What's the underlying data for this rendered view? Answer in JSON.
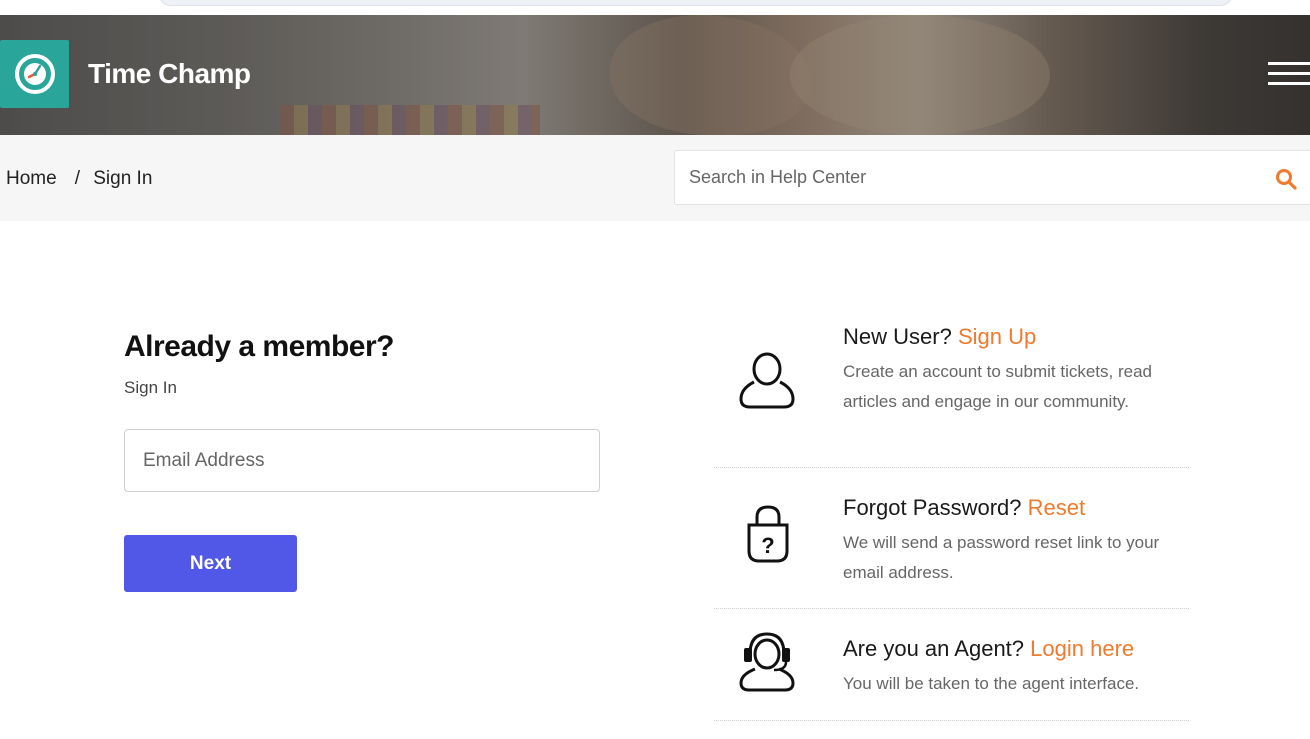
{
  "header": {
    "brand": "Time Champ",
    "menu_icon": "hamburger-menu-icon",
    "logo_icon": "clock-icon",
    "accent_color": "#2aa59a"
  },
  "breadcrumb": {
    "home": "Home",
    "separator": "/",
    "current": "Sign In"
  },
  "search": {
    "placeholder": "Search in Help Center",
    "icon": "search-icon",
    "icon_color": "#f07a2d"
  },
  "login": {
    "title": "Already a member?",
    "subtitle": "Sign In",
    "email_placeholder": "Email Address",
    "next_label": "Next",
    "button_color": "#5157e6"
  },
  "options": [
    {
      "icon": "user-icon",
      "title": "New User?",
      "link": "Sign Up",
      "description": "Create an account to submit tickets, read articles and engage in our community."
    },
    {
      "icon": "lock-question-icon",
      "title": "Forgot Password?",
      "link": "Reset",
      "description": "We will send a password reset link to your email address."
    },
    {
      "icon": "headset-agent-icon",
      "title": "Are you an Agent?",
      "link": "Login here",
      "description": "You will be taken to the agent interface."
    }
  ],
  "link_color": "#f07a2d"
}
